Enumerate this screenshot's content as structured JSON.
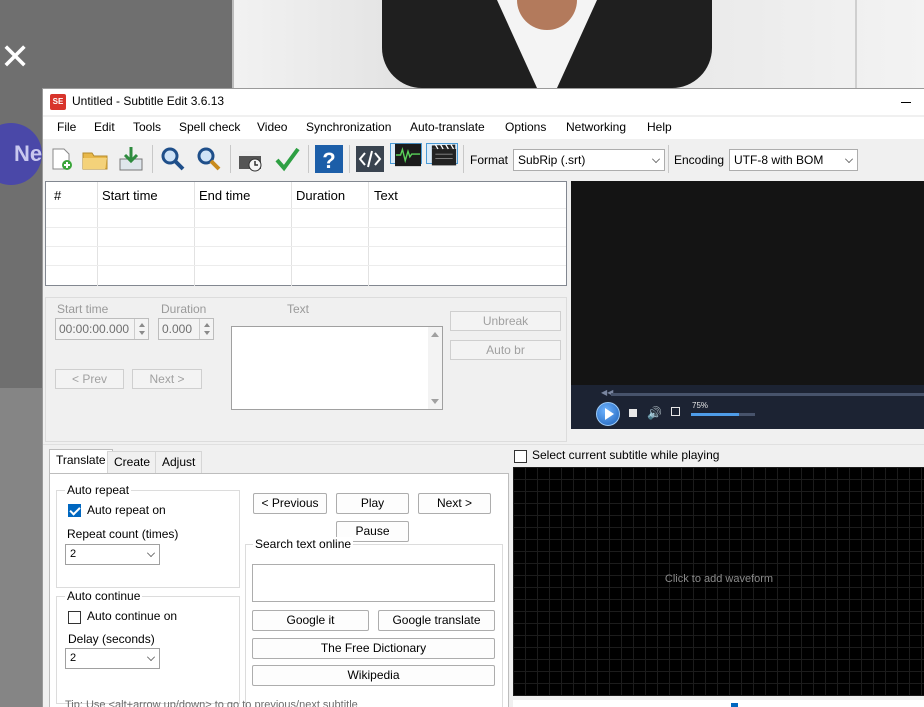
{
  "window": {
    "title": "Untitled - Subtitle Edit 3.6.13",
    "app_icon_text": "SE"
  },
  "background": {
    "close_glyph": "✕",
    "pill_text": "Ne"
  },
  "menu": [
    "File",
    "Edit",
    "Tools",
    "Spell check",
    "Video",
    "Synchronization",
    "Auto-translate",
    "Options",
    "Networking",
    "Help"
  ],
  "toolbar": {
    "buttons": [
      "new-file-icon",
      "open-folder-icon",
      "save-download-icon",
      "find-icon",
      "replace-icon",
      "visual-sync-icon",
      "spell-check-icon",
      "help-icon",
      "source-view-icon",
      "waveform-toggle-icon",
      "video-toggle-icon"
    ],
    "format_label": "Format",
    "format_value": "SubRip (.srt)",
    "encoding_label": "Encoding",
    "encoding_value": "UTF-8 with BOM"
  },
  "subtitle_list": {
    "columns": [
      "#",
      "Start time",
      "End time",
      "Duration",
      "Text"
    ]
  },
  "edit": {
    "start_time_label": "Start time",
    "duration_label": "Duration",
    "text_label": "Text",
    "start_time_value": "00:00:00.000",
    "duration_value": "0.000",
    "unbreak_label": "Unbreak",
    "auto_br_label": "Auto br",
    "prev_label": "< Prev",
    "next_label": "Next >"
  },
  "video": {
    "volume_percent_text": "75%",
    "volume_level": 0.75
  },
  "tabs": [
    "Translate",
    "Create",
    "Adjust"
  ],
  "translate": {
    "auto_repeat_title": "Auto repeat",
    "auto_repeat_on_label": "Auto repeat on",
    "auto_repeat_on_checked": true,
    "repeat_count_label": "Repeat count (times)",
    "repeat_count_value": "2",
    "auto_continue_title": "Auto continue",
    "auto_continue_on_label": "Auto continue on",
    "auto_continue_on_checked": false,
    "delay_label": "Delay (seconds)",
    "delay_value": "2",
    "previous_label": "< Previous",
    "play_label": "Play",
    "next_label": "Next >",
    "pause_label": "Pause",
    "search_title": "Search text online",
    "google_it_label": "Google it",
    "google_translate_label": "Google translate",
    "free_dictionary_label": "The Free Dictionary",
    "wikipedia_label": "Wikipedia",
    "tip": "Tip: Use <alt+arrow up/down> to go to previous/next subtitle"
  },
  "waveform": {
    "select_current_label": "Select current subtitle while playing",
    "click_hint": "Click to add waveform"
  }
}
